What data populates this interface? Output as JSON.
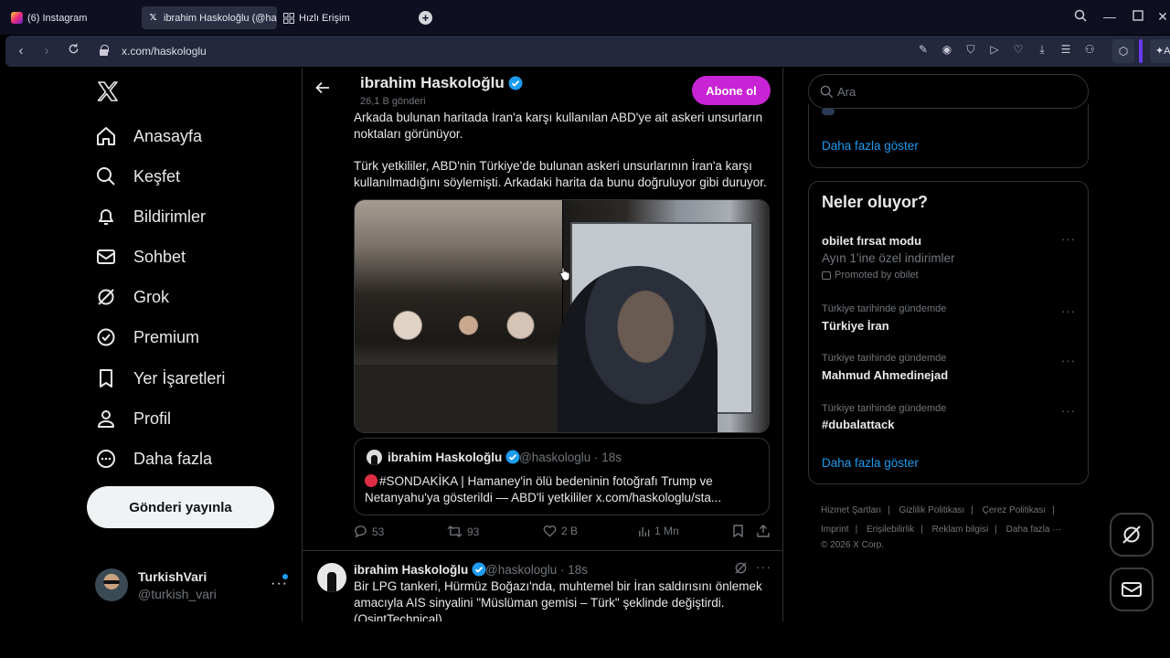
{
  "browser": {
    "tabs": [
      {
        "label": "(6) Instagram",
        "favicon": "instagram-icon",
        "active": false
      },
      {
        "label": "ibrahim Haskoloğlu (@has",
        "favicon": "x-icon",
        "active": true
      },
      {
        "label": "Hızlı Erişim",
        "favicon": "grid-icon",
        "active": false
      }
    ],
    "url": "x.com/haskologlu",
    "extension_label": "A"
  },
  "nav": {
    "items": [
      {
        "label": "Anasayfa",
        "icon": "home-icon"
      },
      {
        "label": "Keşfet",
        "icon": "search-icon"
      },
      {
        "label": "Bildirimler",
        "icon": "bell-icon"
      },
      {
        "label": "Sohbet",
        "icon": "mail-icon"
      },
      {
        "label": "Grok",
        "icon": "grok-icon"
      },
      {
        "label": "Premium",
        "icon": "premium-icon"
      },
      {
        "label": "Yer İşaretleri",
        "icon": "bookmark-icon"
      },
      {
        "label": "Profil",
        "icon": "person-icon"
      },
      {
        "label": "Daha fazla",
        "icon": "more-circle-icon"
      }
    ],
    "post_button": "Gönderi yayınla",
    "account": {
      "name": "TurkishVari",
      "handle": "@turkish_vari"
    }
  },
  "profile_header": {
    "name": "ibrahim Haskoloğlu",
    "post_count": "26,1 B gönderi",
    "subscribe_label": "Abone ol"
  },
  "tweet": {
    "text1": "Arkada bulunan haritada İran'a karşı kullanılan ABD'ye ait askeri unsurların noktaları görünüyor.",
    "text2": "Türk yetkililer, ABD'nin Türkiye'de bulunan askeri unsurlarının İran'a karşı kullanılmadığını söylemişti. Arkadaki harita da bunu doğruluyor gibi duruyor.",
    "quote": {
      "name": "ibrahim Haskoloğlu",
      "handle": "@haskologlu",
      "time": "18s",
      "text": "#SONDAKİKA | Hamaney'in ölü bedeninin fotoğrafı Trump ve Netanyahu'ya gösterildi — ABD'li yetkililer x.com/haskologlu/sta..."
    },
    "stats": {
      "replies": "53",
      "reposts": "93",
      "likes": "2 B",
      "views": "1 Mn"
    }
  },
  "tweet2": {
    "name": "ibrahim Haskoloğlu",
    "handle": "@haskologlu",
    "time": "18s",
    "text": "Bir LPG tankeri, Hürmüz Boğazı'nda, muhtemel bir İran saldırısını önlemek amacıyla AIS sinyalini \"Müslüman gemisi – Türk\" şeklinde değiştirdi. (OsintTechnical)"
  },
  "right": {
    "search_placeholder": "Ara",
    "show_more": "Daha fazla göster",
    "trends_title": "Neler oluyor?",
    "promoted": {
      "title": "obilet fırsat modu",
      "desc": "Ayın 1'ine özel indirimler",
      "promo": "Promoted by obilet"
    },
    "trends": [
      {
        "context": "Türkiye tarihinde gündemde",
        "title": "Türkiye İran"
      },
      {
        "context": "Türkiye tarihinde gündemde",
        "title": "Mahmud Ahmedinejad"
      },
      {
        "context": "Türkiye tarihinde gündemde",
        "title": "#dubalattack"
      }
    ],
    "show_more2": "Daha fazla göster",
    "footer": {
      "terms": "Hizmet Şartları",
      "privacy": "Gizlilik Politikası",
      "cookies": "Çerez Politikası",
      "imprint": "Imprint",
      "accessibility": "Erişilebilirlik",
      "ads": "Reklam bilgisi",
      "more": "Daha fazla ···",
      "copyright": "© 2026 X Corp."
    }
  },
  "colors": {
    "accent": "#1d9bf0",
    "subscribe": "#c823d4",
    "background": "#000000"
  }
}
